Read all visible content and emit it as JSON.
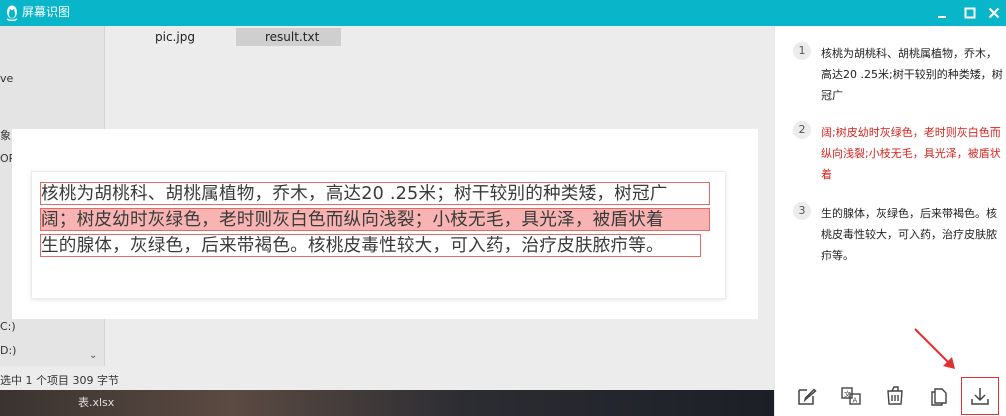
{
  "app": {
    "title": "屏幕识图",
    "controls": [
      "minimize",
      "maximize",
      "close"
    ]
  },
  "explorer": {
    "nav_items": [
      "ve",
      "象",
      "OR",
      "C:)",
      "D:)"
    ],
    "files": [
      "pic.jpg",
      "result.txt"
    ],
    "selected_file": "result.txt",
    "status": "选中 1 个项目  309 字节",
    "taskbar_text": "表.xlsx"
  },
  "ocr_preview": {
    "lines": [
      {
        "text": "核桃为胡桃科、胡桃属植物，乔木，高达20 .25米；树干较别的种类矮，树冠广",
        "highlighted": false
      },
      {
        "text": "阔；树皮幼时灰绿色，老时则灰白色而纵向浅裂；小枝无毛，具光泽，被盾状着",
        "highlighted": true
      },
      {
        "text": "生的腺体，灰绿色，后来带褐色。核桃皮毒性较大，可入药，治疗皮肤脓疖等。",
        "highlighted": false
      }
    ]
  },
  "results": [
    {
      "index": "1",
      "text": "核桃为胡桃科、胡桃属植物，乔木，高达20 .25米;树干较别的种类矮，树冠广",
      "color": "#222222"
    },
    {
      "index": "2",
      "text": "阔;树皮幼时灰绿色，老时则灰白色而纵向浅裂;小枝无毛，具光泽，被盾状着",
      "color": "#d9241e"
    },
    {
      "index": "3",
      "text": "生的腺体，灰绿色，后来带褐色。核桃皮毒性较大，可入药，治疗皮肤脓疖等。",
      "color": "#222222"
    }
  ],
  "toolbar": {
    "icons": [
      "edit-icon",
      "translate-icon",
      "clear-icon",
      "copy-icon",
      "download-icon"
    ],
    "active": "download-icon"
  },
  "colors": {
    "titlebar": "#08b5c9",
    "highlight": "#f8b3b3",
    "highlight_border": "#e46a6a",
    "accent_red": "#e03131"
  }
}
